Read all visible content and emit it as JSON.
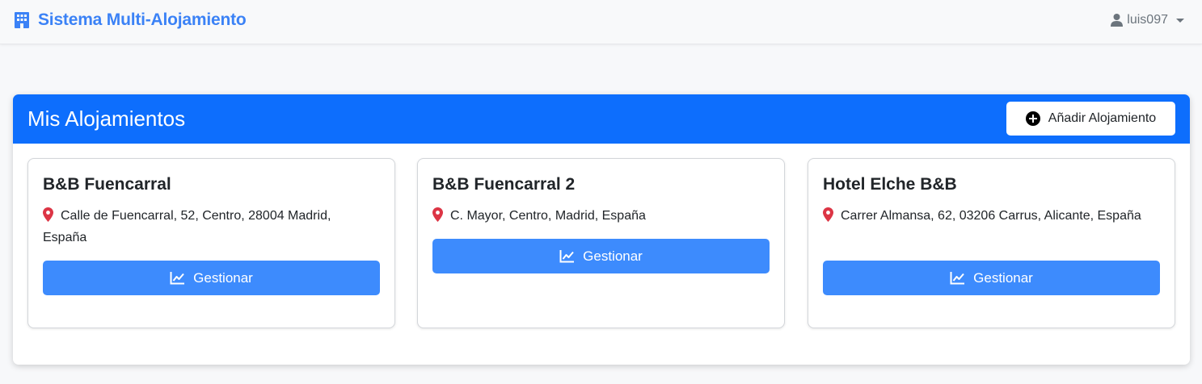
{
  "navbar": {
    "brand_icon": "building-icon",
    "brand": "Sistema Multi-Alojamiento",
    "user_icon": "user-icon",
    "username": "luis097"
  },
  "panel": {
    "title": "Mis Alojamientos",
    "add_button_icon": "plus-circle-icon",
    "add_button": "Añadir Alojamiento"
  },
  "properties": [
    {
      "name": "B&B Fuencarral",
      "address": "Calle de Fuencarral, 52, Centro, 28004 Madrid, España",
      "button": "Gestionar"
    },
    {
      "name": "B&B Fuencarral 2",
      "address": "C. Mayor, Centro, Madrid, España",
      "button": "Gestionar"
    },
    {
      "name": "Hotel Elche B&B",
      "address": "Carrer Almansa, 62, 03206 Carrus, Alicante, España",
      "button": "Gestionar"
    }
  ],
  "icons": {
    "address": "map-pin-icon",
    "manage": "line-chart-icon"
  },
  "colors": {
    "primary": "#0d6efd",
    "brand": "#3b82f6",
    "button": "#3d8bfd",
    "pin": "#dc3545"
  }
}
